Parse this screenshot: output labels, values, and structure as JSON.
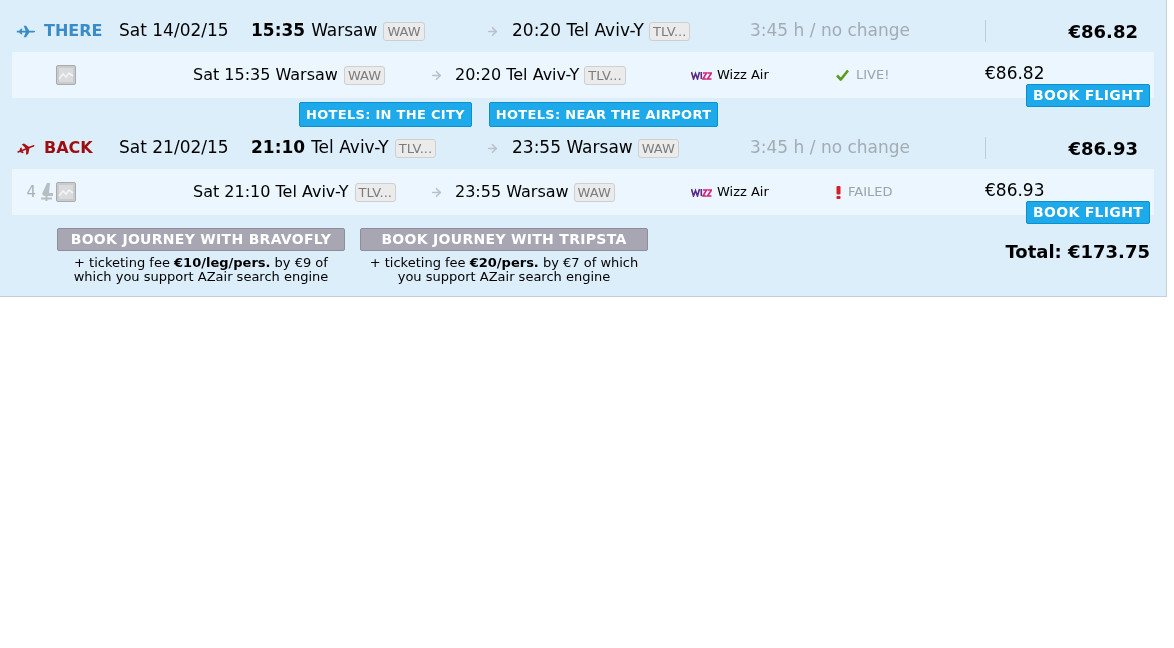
{
  "legs": [
    {
      "kind": "there",
      "label": "THERE",
      "date": "Sat 14/02/15",
      "departure_time": "15:35",
      "departure_city": "Warsaw",
      "departure_code": "WAW",
      "arrival": "20:20 Tel Aviv-Y",
      "arrival_code": "TLV...",
      "duration": "3:45 h / no change",
      "price": "€86.82",
      "flights": [
        {
          "kind": "live",
          "departure": "Sat 15:35 Warsaw",
          "departure_code": "WAW",
          "arrival": "20:20 Tel Aviv-Y",
          "arrival_code": "TLV...",
          "airline": "Wizz Air",
          "status_label": "LIVE!",
          "price": "€86.82",
          "book_button": "BOOK FLIGHT"
        }
      ],
      "hotel_buttons": [
        "HOTELS: IN THE CITY",
        "HOTELS: NEAR THE AIRPORT"
      ]
    },
    {
      "kind": "back",
      "label": "BACK",
      "date": "Sat 21/02/15",
      "departure_time": "21:10",
      "departure_city": "Tel Aviv-Y",
      "departure_code": "TLV...",
      "arrival": "23:55 Warsaw",
      "arrival_code": "WAW",
      "duration": "3:45 h / no change",
      "price": "€86.93",
      "flights": [
        {
          "kind": "failed",
          "seats": "4",
          "departure": "Sat 21:10 Tel Aviv-Y",
          "departure_code": "TLV...",
          "arrival": "23:55 Warsaw",
          "arrival_code": "WAW",
          "airline": "Wizz Air",
          "status_label": "FAILED",
          "price": "€86.93",
          "book_button": "BOOK FLIGHT"
        }
      ]
    }
  ],
  "booking_options": [
    {
      "button": "BOOK JOURNEY WITH BRAVOFLY",
      "note": "+ ticketing fee **€10/leg/pers.** by €9 of which you support AZair search engine"
    },
    {
      "button": "BOOK JOURNEY WITH TRIPSTA",
      "note": "+ ticketing fee **€20/pers.** by €7 of which you support AZair search engine"
    }
  ],
  "total": "Total: €173.75"
}
